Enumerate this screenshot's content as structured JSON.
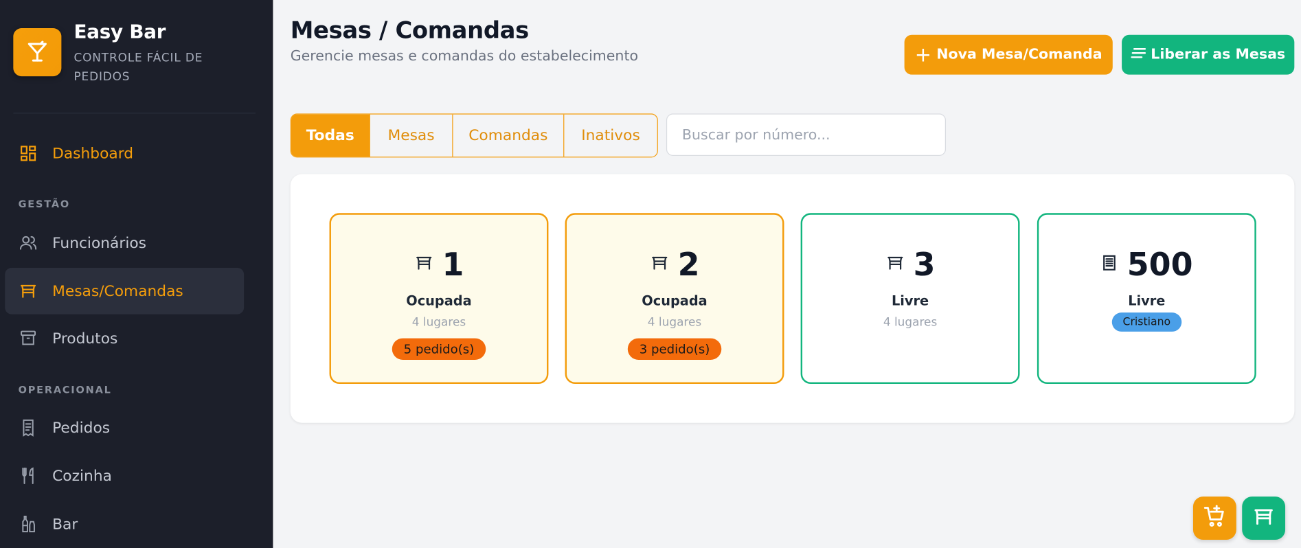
{
  "brand": {
    "title": "Easy Bar",
    "subtitle": "CONTROLE FÁCIL DE PEDIDOS",
    "icon": "cocktail-icon"
  },
  "sidebar": {
    "dashboard": {
      "label": "Dashboard",
      "icon": "dashboard-icon"
    },
    "sections": {
      "gestao": "GESTÃO",
      "operacional": "OPERACIONAL"
    },
    "items": [
      {
        "label": "Funcionários",
        "icon": "users-icon"
      },
      {
        "label": "Mesas/Comandas",
        "icon": "table-icon",
        "active": true
      },
      {
        "label": "Produtos",
        "icon": "archive-icon"
      },
      {
        "label": "Pedidos",
        "icon": "receipt-icon"
      },
      {
        "label": "Cozinha",
        "icon": "utensils-icon"
      },
      {
        "label": "Bar",
        "icon": "bottles-icon"
      }
    ]
  },
  "header": {
    "title": "Mesas / Comandas",
    "subtitle": "Gerencie mesas e comandas do estabelecimento",
    "new_button": "Nova Mesa/Comanda",
    "release_button": "Liberar as Mesas"
  },
  "filters": {
    "tabs": [
      "Todas",
      "Mesas",
      "Comandas",
      "Inativos"
    ],
    "active_tab": "Todas",
    "search_placeholder": "Buscar por número..."
  },
  "cards": [
    {
      "type": "mesa",
      "icon": "table-icon",
      "number": "1",
      "status": "Ocupada",
      "seats": "4 lugares",
      "orders": "5 pedido(s)"
    },
    {
      "type": "mesa",
      "icon": "table-icon",
      "number": "2",
      "status": "Ocupada",
      "seats": "4 lugares",
      "orders": "3 pedido(s)"
    },
    {
      "type": "mesa",
      "icon": "table-icon",
      "number": "3",
      "status": "Livre",
      "seats": "4 lugares"
    },
    {
      "type": "comanda",
      "icon": "receipt-icon",
      "number": "500",
      "status": "Livre",
      "person": "Cristiano"
    }
  ],
  "colors": {
    "sidebar_bg": "#1c1f2a",
    "accent_orange": "#f39c0b",
    "accent_green": "#12b57e",
    "orders_badge": "#f36b0b",
    "person_badge": "#4a9fe8"
  },
  "fabs": [
    {
      "icon": "cart-plus-icon"
    },
    {
      "icon": "table-icon"
    }
  ]
}
